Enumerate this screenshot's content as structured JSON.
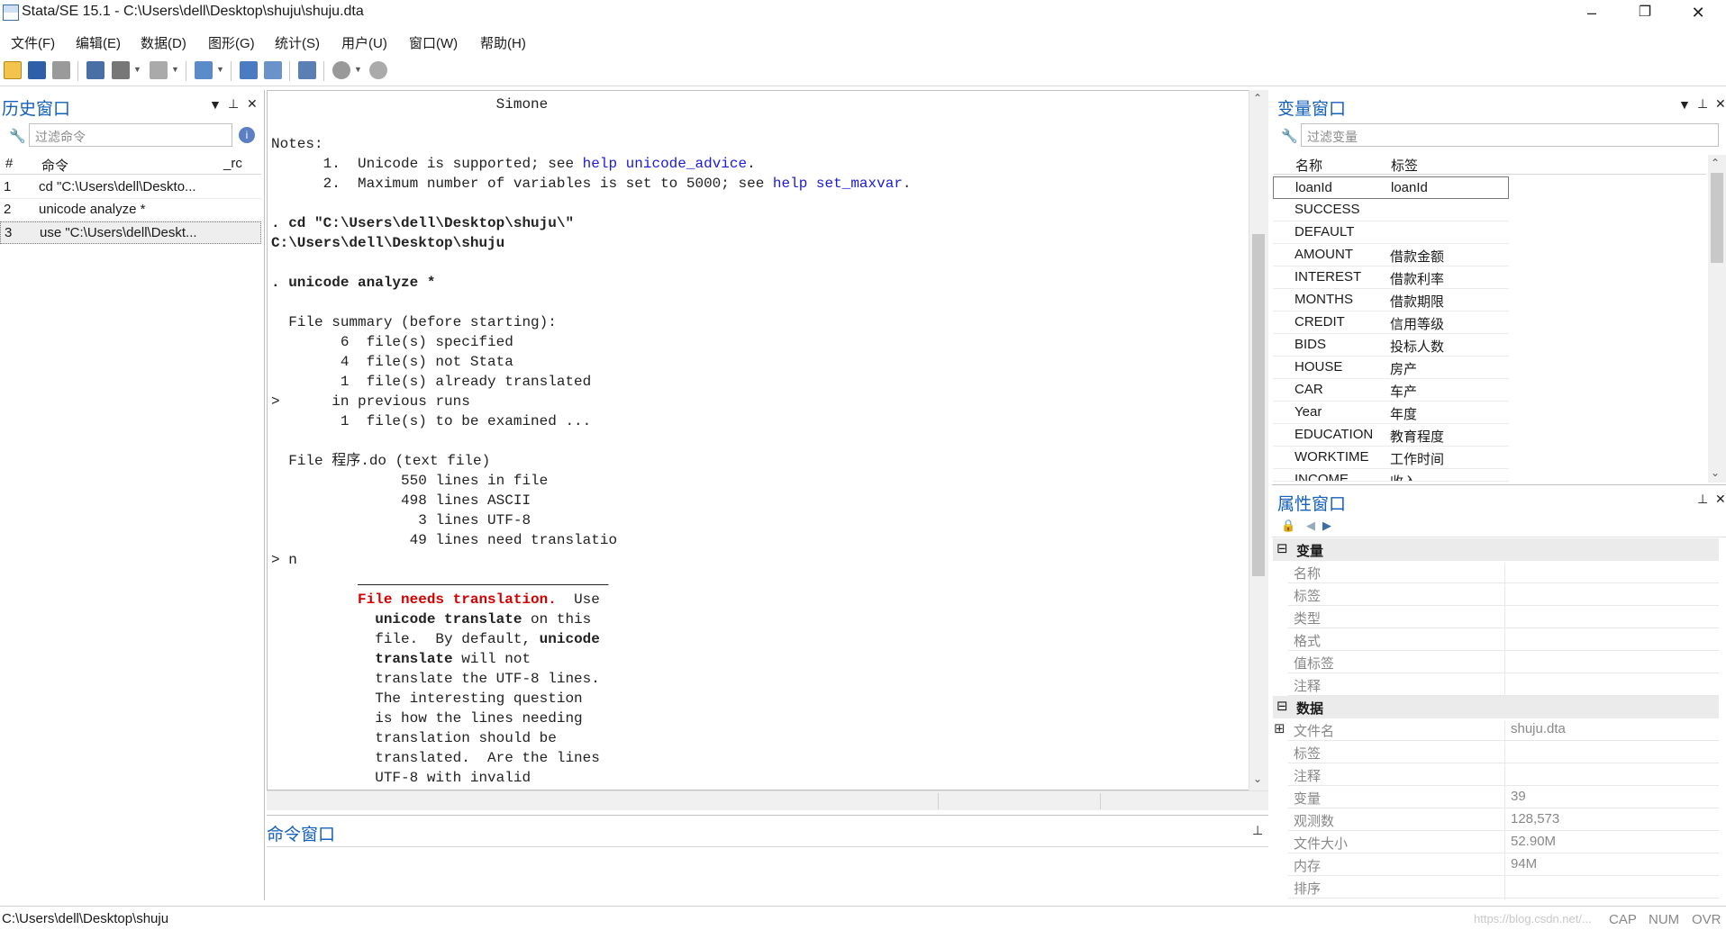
{
  "window": {
    "title": "Stata/SE 15.1 - C:\\Users\\dell\\Desktop\\shuju\\shuju.dta",
    "minimize": "–",
    "maximize": "❐",
    "close": "✕"
  },
  "menu": [
    "文件(F)",
    "编辑(E)",
    "数据(D)",
    "图形(G)",
    "统计(S)",
    "用户(U)",
    "窗口(W)",
    "帮助(H)"
  ],
  "toolbar": {
    "icons": [
      "open-icon",
      "save-icon",
      "print-icon",
      "log-icon",
      "viewer-icon",
      "graph-icon",
      "do-file-editor-icon",
      "data-editor-icon",
      "data-browser-icon",
      "variables-manager-icon",
      "more-icon",
      "break-icon"
    ]
  },
  "history": {
    "title": "历史窗口",
    "filter_placeholder": "过滤命令",
    "col_num": "#",
    "col_cmd": "命令",
    "col_rc": "_rc",
    "rows": [
      {
        "n": "1",
        "cmd": "cd \"C:\\Users\\dell\\Deskto..."
      },
      {
        "n": "2",
        "cmd": "unicode analyze *"
      },
      {
        "n": "3",
        "cmd": "use \"C:\\Users\\dell\\Deskt..."
      }
    ]
  },
  "results": {
    "simone": "Simone",
    "notes": "Notes:",
    "note1_pre": "1.  Unicode is supported; see ",
    "note1_help": "help",
    "note1_link": "unicode_advice",
    "note1_post": ".",
    "note2_pre": "2.  Maximum number of variables is set to 5000; see ",
    "note2_help": "help",
    "note2_link": "set_maxvar",
    "note2_post": ".",
    "cmd_cd": ". cd \"C:\\Users\\dell\\Desktop\\shuju\\\"",
    "cd_out": "C:\\Users\\dell\\Desktop\\shuju",
    "cmd_unicode": ". unicode analyze *",
    "summary": "File summary (before starting):",
    "s1": "6  file(s) specified",
    "s2": "4  file(s) not Stata",
    "s3": "1  file(s) already translated",
    "s4_marker": ">",
    "s4": "in previous runs",
    "s5": "1  file(s) to be examined ...",
    "file_line": "File 程序.do (text file)",
    "f1": "550 lines in file",
    "f2": "498 lines ASCII",
    "f3": "3 lines UTF-8",
    "f4": "49 lines need translatio",
    "prompt": "> n",
    "warn_red": "File needs translation.",
    "warn_1b": "  Use",
    "warn_2a": "unicode translate",
    "warn_2b": " on this",
    "warn_3a": "file.  By default, ",
    "warn_3b": "unicode",
    "warn_4a": "translate",
    "warn_4b": " will not",
    "warn_5": "translate the UTF-8 lines.",
    "warn_6": "The interesting question",
    "warn_7": "is how the lines needing",
    "warn_8": "translation should be",
    "warn_9": "translated.  Are the lines",
    "warn_10": "UTF-8 with invalid"
  },
  "command": {
    "title": "命令窗口"
  },
  "variables": {
    "title": "变量窗口",
    "filter_placeholder": "过滤变量",
    "col_name": "名称",
    "col_label": "标签",
    "rows": [
      {
        "name": "loanId",
        "label": "loanId"
      },
      {
        "name": "SUCCESS",
        "label": ""
      },
      {
        "name": "DEFAULT",
        "label": ""
      },
      {
        "name": "AMOUNT",
        "label": "借款金额"
      },
      {
        "name": "INTEREST",
        "label": "借款利率"
      },
      {
        "name": "MONTHS",
        "label": "借款期限"
      },
      {
        "name": "CREDIT",
        "label": "信用等级"
      },
      {
        "name": "BIDS",
        "label": "投标人数"
      },
      {
        "name": "HOUSE",
        "label": "房产"
      },
      {
        "name": "CAR",
        "label": "车产"
      },
      {
        "name": "Year",
        "label": "年度"
      },
      {
        "name": "EDUCATION",
        "label": "教育程度"
      },
      {
        "name": "WORKTIME",
        "label": "工作时间"
      },
      {
        "name": "INCOME",
        "label": "收入"
      }
    ]
  },
  "properties": {
    "title": "属性窗口",
    "sec_var": "变量",
    "var_rows": [
      {
        "k": "名称",
        "v": ""
      },
      {
        "k": "标签",
        "v": ""
      },
      {
        "k": "类型",
        "v": ""
      },
      {
        "k": "格式",
        "v": ""
      },
      {
        "k": "值标签",
        "v": ""
      },
      {
        "k": "注释",
        "v": ""
      }
    ],
    "sec_data": "数据",
    "data_rows": [
      {
        "k": "文件名",
        "v": "shuju.dta"
      },
      {
        "k": "标签",
        "v": ""
      },
      {
        "k": "注释",
        "v": ""
      },
      {
        "k": "变量",
        "v": "39"
      },
      {
        "k": "观测数",
        "v": "128,573"
      },
      {
        "k": "文件大小",
        "v": "52.90M"
      },
      {
        "k": "内存",
        "v": "94M"
      },
      {
        "k": "排序",
        "v": ""
      }
    ]
  },
  "status": {
    "path": "C:\\Users\\dell\\Desktop\\shuju",
    "watermark": "https://blog.csdn.net/...",
    "cap": "CAP",
    "num": "NUM",
    "ovr": "OVR"
  }
}
